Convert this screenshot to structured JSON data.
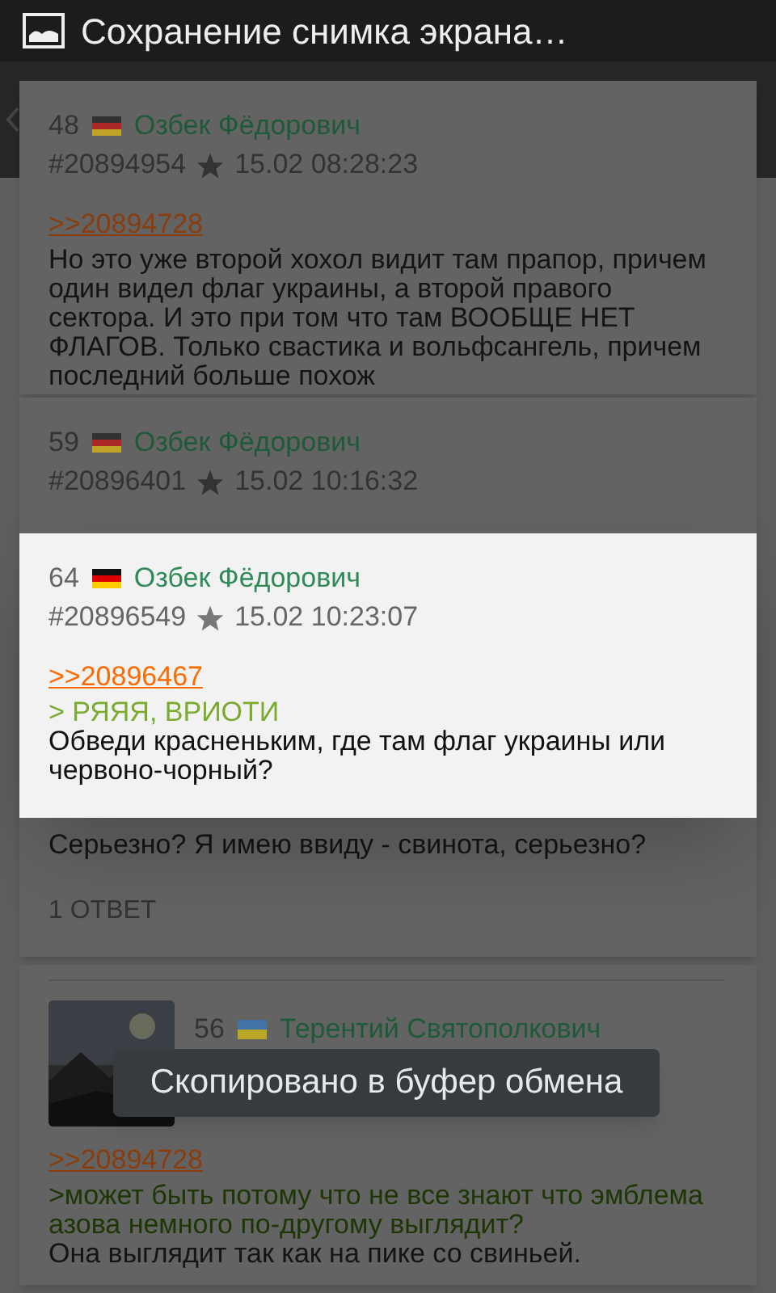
{
  "notification": {
    "title": "Сохранение снимка экрана…"
  },
  "posts": [
    {
      "highlighted": false,
      "number": "48",
      "flag": {
        "kind": "de"
      },
      "name": "Озбек Фёдорович",
      "post_id": "#20894954",
      "date": "15.02 08:28:23",
      "body": [
        {
          "kind": "link",
          "text": ">>20894728"
        },
        {
          "kind": "text",
          "text": "Но это уже второй хохол видит там прапор, причем один видел флаг украины, а второй правого сектора. И это при том что там ВООБЩЕ НЕТ ФЛАГОВ. Только свастика и вольфсангель, причем последний больше похож"
        }
      ]
    },
    {
      "highlighted": false,
      "number": "59",
      "flag": {
        "kind": "de"
      },
      "name": "Озбек Фёдорович",
      "post_id": "#20896401",
      "date": "15.02 10:16:32",
      "body": [
        {
          "kind": "text",
          "text": "Серьезно? Я имею ввиду - свинота, серьезно?"
        }
      ],
      "replies": "1 ОТВЕТ"
    },
    {
      "highlighted": true,
      "number": "64",
      "flag": {
        "kind": "de"
      },
      "name": "Озбек Фёдорович",
      "post_id": "#20896549",
      "date": "15.02 10:23:07",
      "body": [
        {
          "kind": "link",
          "text": ">>20896467"
        },
        {
          "kind": "quote",
          "text": "> РЯЯЯ, ВРИОТИ"
        },
        {
          "kind": "text",
          "text": "Обведи красненьким, где там флаг украины или червоно-чорный?"
        }
      ]
    },
    {
      "highlighted": false,
      "number": "56",
      "flag": {
        "kind": "ua"
      },
      "name": "Терентий Святополкович",
      "thumbnail": {
        "kind": "picture"
      },
      "body": [
        {
          "kind": "link",
          "text": ">>20894728"
        },
        {
          "kind": "quote",
          "text": ">может быть потому что не все знают что эмблема азова немного по-другому выглядит?"
        },
        {
          "kind": "text",
          "text": "Она выглядит так как на пике со свиньей."
        }
      ]
    }
  ],
  "toast": {
    "text": "Скопировано в буфер обмена"
  }
}
